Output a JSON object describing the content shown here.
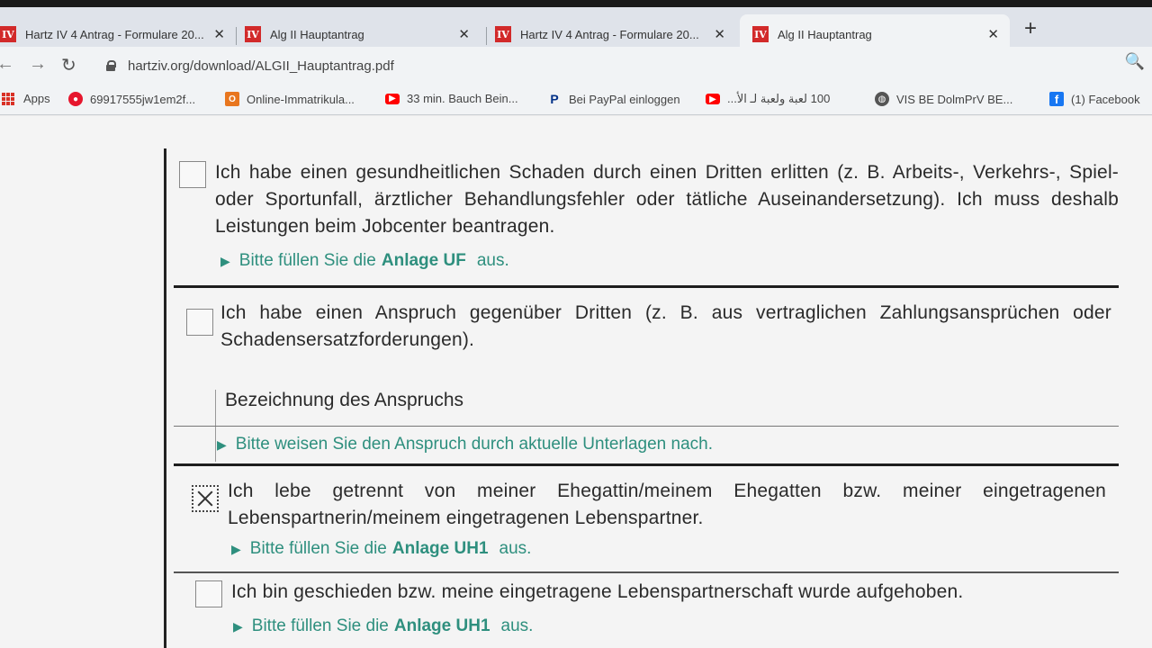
{
  "tabs": [
    {
      "label": "Hartz IV 4 Antrag - Formulare 20...",
      "favicon": "IV"
    },
    {
      "label": "Alg II Hauptantrag",
      "favicon": "IV"
    },
    {
      "label": "Hartz IV 4 Antrag - Formulare 20...",
      "favicon": "IV"
    },
    {
      "label": "Alg II Hauptantrag",
      "favicon": "IV",
      "active": true
    }
  ],
  "toolbar": {
    "url": "hartziv.org/download/ALGII_Hauptantrag.pdf"
  },
  "bookmarks": [
    {
      "label": "Apps",
      "icon": "apps-grid-icon"
    },
    {
      "label": "69917555jw1em2f...",
      "icon": "weibo-icon"
    },
    {
      "label": "Online-Immatrikula...",
      "icon": "portal-icon"
    },
    {
      "label": "33 min. Bauch Bein...",
      "icon": "youtube-icon"
    },
    {
      "label": "Bei PayPal einloggen",
      "icon": "paypal-icon"
    },
    {
      "label": "100 لعبة ولعبة لـ الأ...",
      "icon": "youtube-icon"
    },
    {
      "label": "VIS BE DolmPrV BE...",
      "icon": "globe-icon"
    },
    {
      "label": "(1) Facebook",
      "icon": "facebook-icon"
    }
  ],
  "form": {
    "item1": {
      "text": "Ich habe einen gesundheitlichen Schaden durch einen Dritten erlitten (z. B. Arbeits-, Verkehrs-, Spiel- oder Sportunfall, ärztlicher Behandlungsfehler oder tätliche Auseinandersetzung). Ich muss deshalb Leistungen beim Jobcenter beantragen.",
      "hint_prefix": "Bitte füllen Sie die",
      "hint_bold": "Anlage UF",
      "hint_suffix": "aus.",
      "checked": false
    },
    "item2": {
      "text": "Ich habe einen Anspruch gegenüber Dritten (z. B. aus vertraglichen Zahlungsansprüchen oder Schadensersatzforderungen).",
      "field_label": "Bezeichnung des Anspruchs",
      "hint": "Bitte weisen Sie den Anspruch durch aktuelle Unterlagen nach.",
      "checked": false
    },
    "item3": {
      "text": "Ich lebe getrennt von meiner Ehegattin/meinem Ehegatten bzw. meiner eingetragenen Lebenspartnerin/meinem eingetragenen Lebenspartner.",
      "hint_prefix": "Bitte füllen Sie die",
      "hint_bold": "Anlage UH1",
      "hint_suffix": "aus.",
      "checked": true
    },
    "item4": {
      "text": "Ich bin geschieden bzw. meine eingetragene Lebenspartnerschaft wurde aufgehoben.",
      "hint_prefix": "Bitte füllen Sie die",
      "hint_bold": "Anlage UH1",
      "hint_suffix": "aus.",
      "checked": false
    }
  }
}
